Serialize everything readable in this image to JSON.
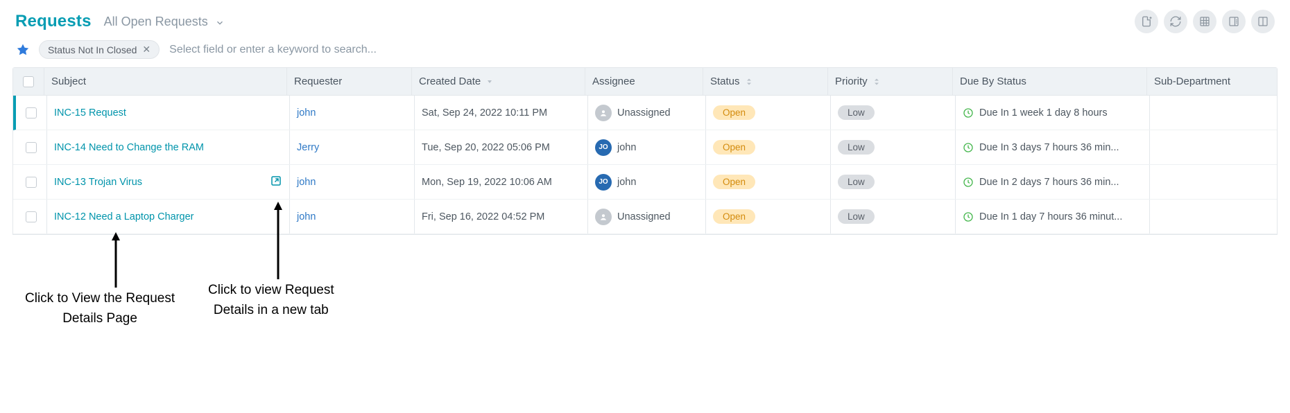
{
  "header": {
    "title": "Requests",
    "filter_label": "All Open Requests"
  },
  "search": {
    "chip_label": "Status Not In Closed",
    "placeholder": "Select field or enter a keyword to search..."
  },
  "columns": {
    "subject": "Subject",
    "requester": "Requester",
    "created": "Created Date",
    "assignee": "Assignee",
    "status": "Status",
    "priority": "Priority",
    "due": "Due By Status",
    "sub": "Sub-Department"
  },
  "rows": [
    {
      "selected": true,
      "show_ext": false,
      "subject": "INC-15 Request",
      "requester": "john",
      "created": "Sat, Sep 24, 2022 10:11 PM",
      "assignee_name": "Unassigned",
      "assignee_type": "blank",
      "assignee_initials": "",
      "status": "Open",
      "priority": "Low",
      "due": "Due In 1 week 1 day 8 hours"
    },
    {
      "selected": false,
      "show_ext": false,
      "subject": "INC-14 Need to Change the RAM",
      "requester": "Jerry",
      "created": "Tue, Sep 20, 2022 05:06 PM",
      "assignee_name": "john",
      "assignee_type": "user",
      "assignee_initials": "JO",
      "status": "Open",
      "priority": "Low",
      "due": "Due In 3 days 7 hours 36 min..."
    },
    {
      "selected": false,
      "show_ext": true,
      "subject": "INC-13 Trojan Virus",
      "requester": "john",
      "created": "Mon, Sep 19, 2022 10:06 AM",
      "assignee_name": "john",
      "assignee_type": "user",
      "assignee_initials": "JO",
      "status": "Open",
      "priority": "Low",
      "due": "Due In 2 days 7 hours 36 min..."
    },
    {
      "selected": false,
      "show_ext": false,
      "subject": "INC-12 Need a Laptop Charger",
      "requester": "john",
      "created": "Fri, Sep 16, 2022 04:52 PM",
      "assignee_name": "Unassigned",
      "assignee_type": "blank",
      "assignee_initials": "",
      "status": "Open",
      "priority": "Low",
      "due": "Due In 1 day 7 hours 36 minut..."
    }
  ],
  "annotations": {
    "details_page": "Click to View the Request\nDetails Page",
    "new_tab": "Click to view Request\nDetails in a new tab"
  }
}
